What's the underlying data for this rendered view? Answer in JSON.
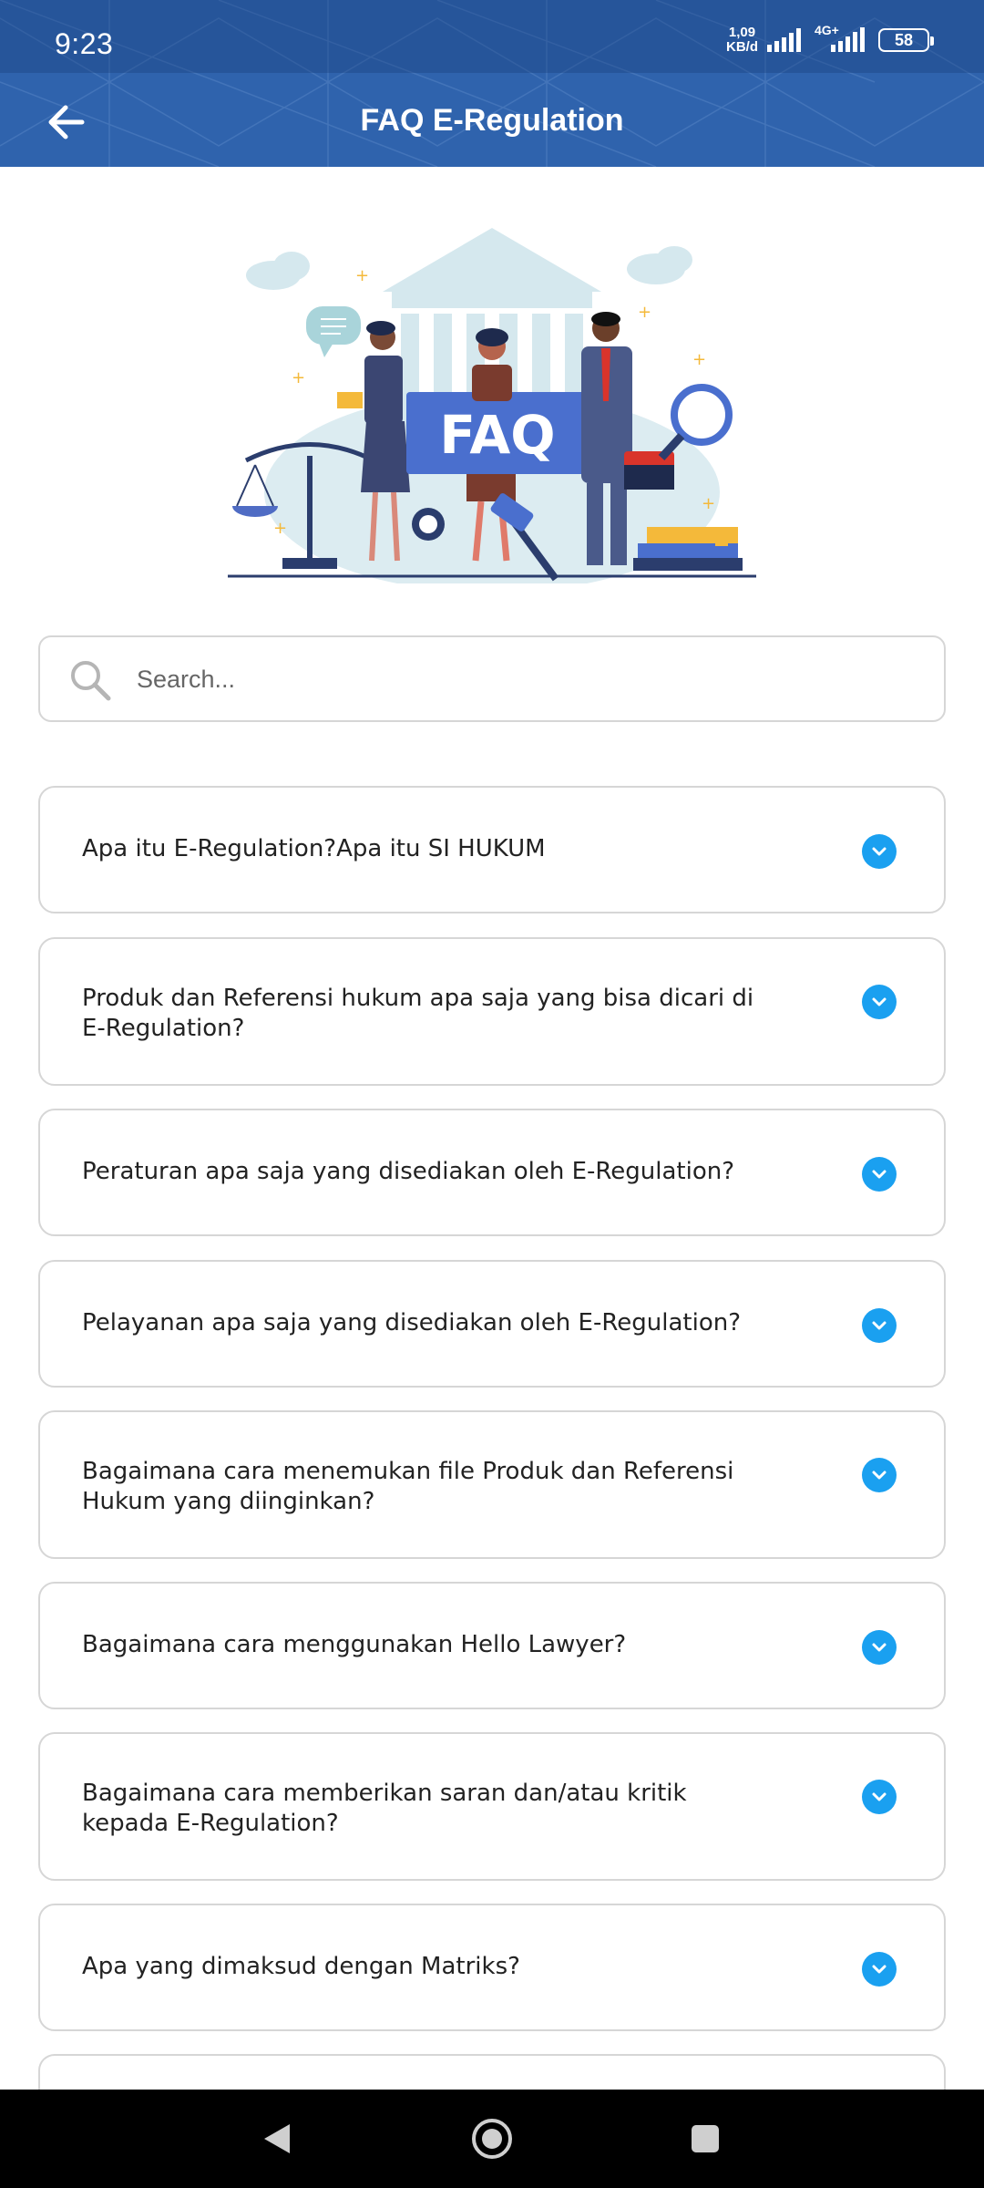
{
  "status_bar": {
    "time": "9:23",
    "net_speed_value": "1,09",
    "net_speed_unit": "KB/d",
    "network_type": "4G+",
    "battery": "58"
  },
  "app_bar": {
    "title": "FAQ E-Regulation",
    "back_icon": "arrow-left-icon"
  },
  "illustration": {
    "badge_text": "FAQ"
  },
  "search": {
    "placeholder": "Search...",
    "value": ""
  },
  "faq": {
    "items": [
      {
        "question": "Apa itu E-Regulation?Apa itu SI HUKUM"
      },
      {
        "question": "Produk dan Referensi hukum apa saja yang bisa dicari di E-Regulation?"
      },
      {
        "question": "Peraturan apa saja yang disediakan oleh E-Regulation?"
      },
      {
        "question": "Pelayanan apa saja yang disediakan oleh E-Regulation?"
      },
      {
        "question": "Bagaimana cara menemukan file Produk dan Referensi Hukum yang diinginkan?"
      },
      {
        "question": "Bagaimana cara menggunakan Hello Lawyer?"
      },
      {
        "question": "Bagaimana cara memberikan saran dan/atau kritik kepada E-Regulation?"
      },
      {
        "question": "Apa yang dimaksud dengan Matriks?"
      }
    ]
  },
  "colors": {
    "header_bg": "#2f63ad",
    "accent": "#1aa0f0",
    "card_border": "#d6d6d6"
  }
}
